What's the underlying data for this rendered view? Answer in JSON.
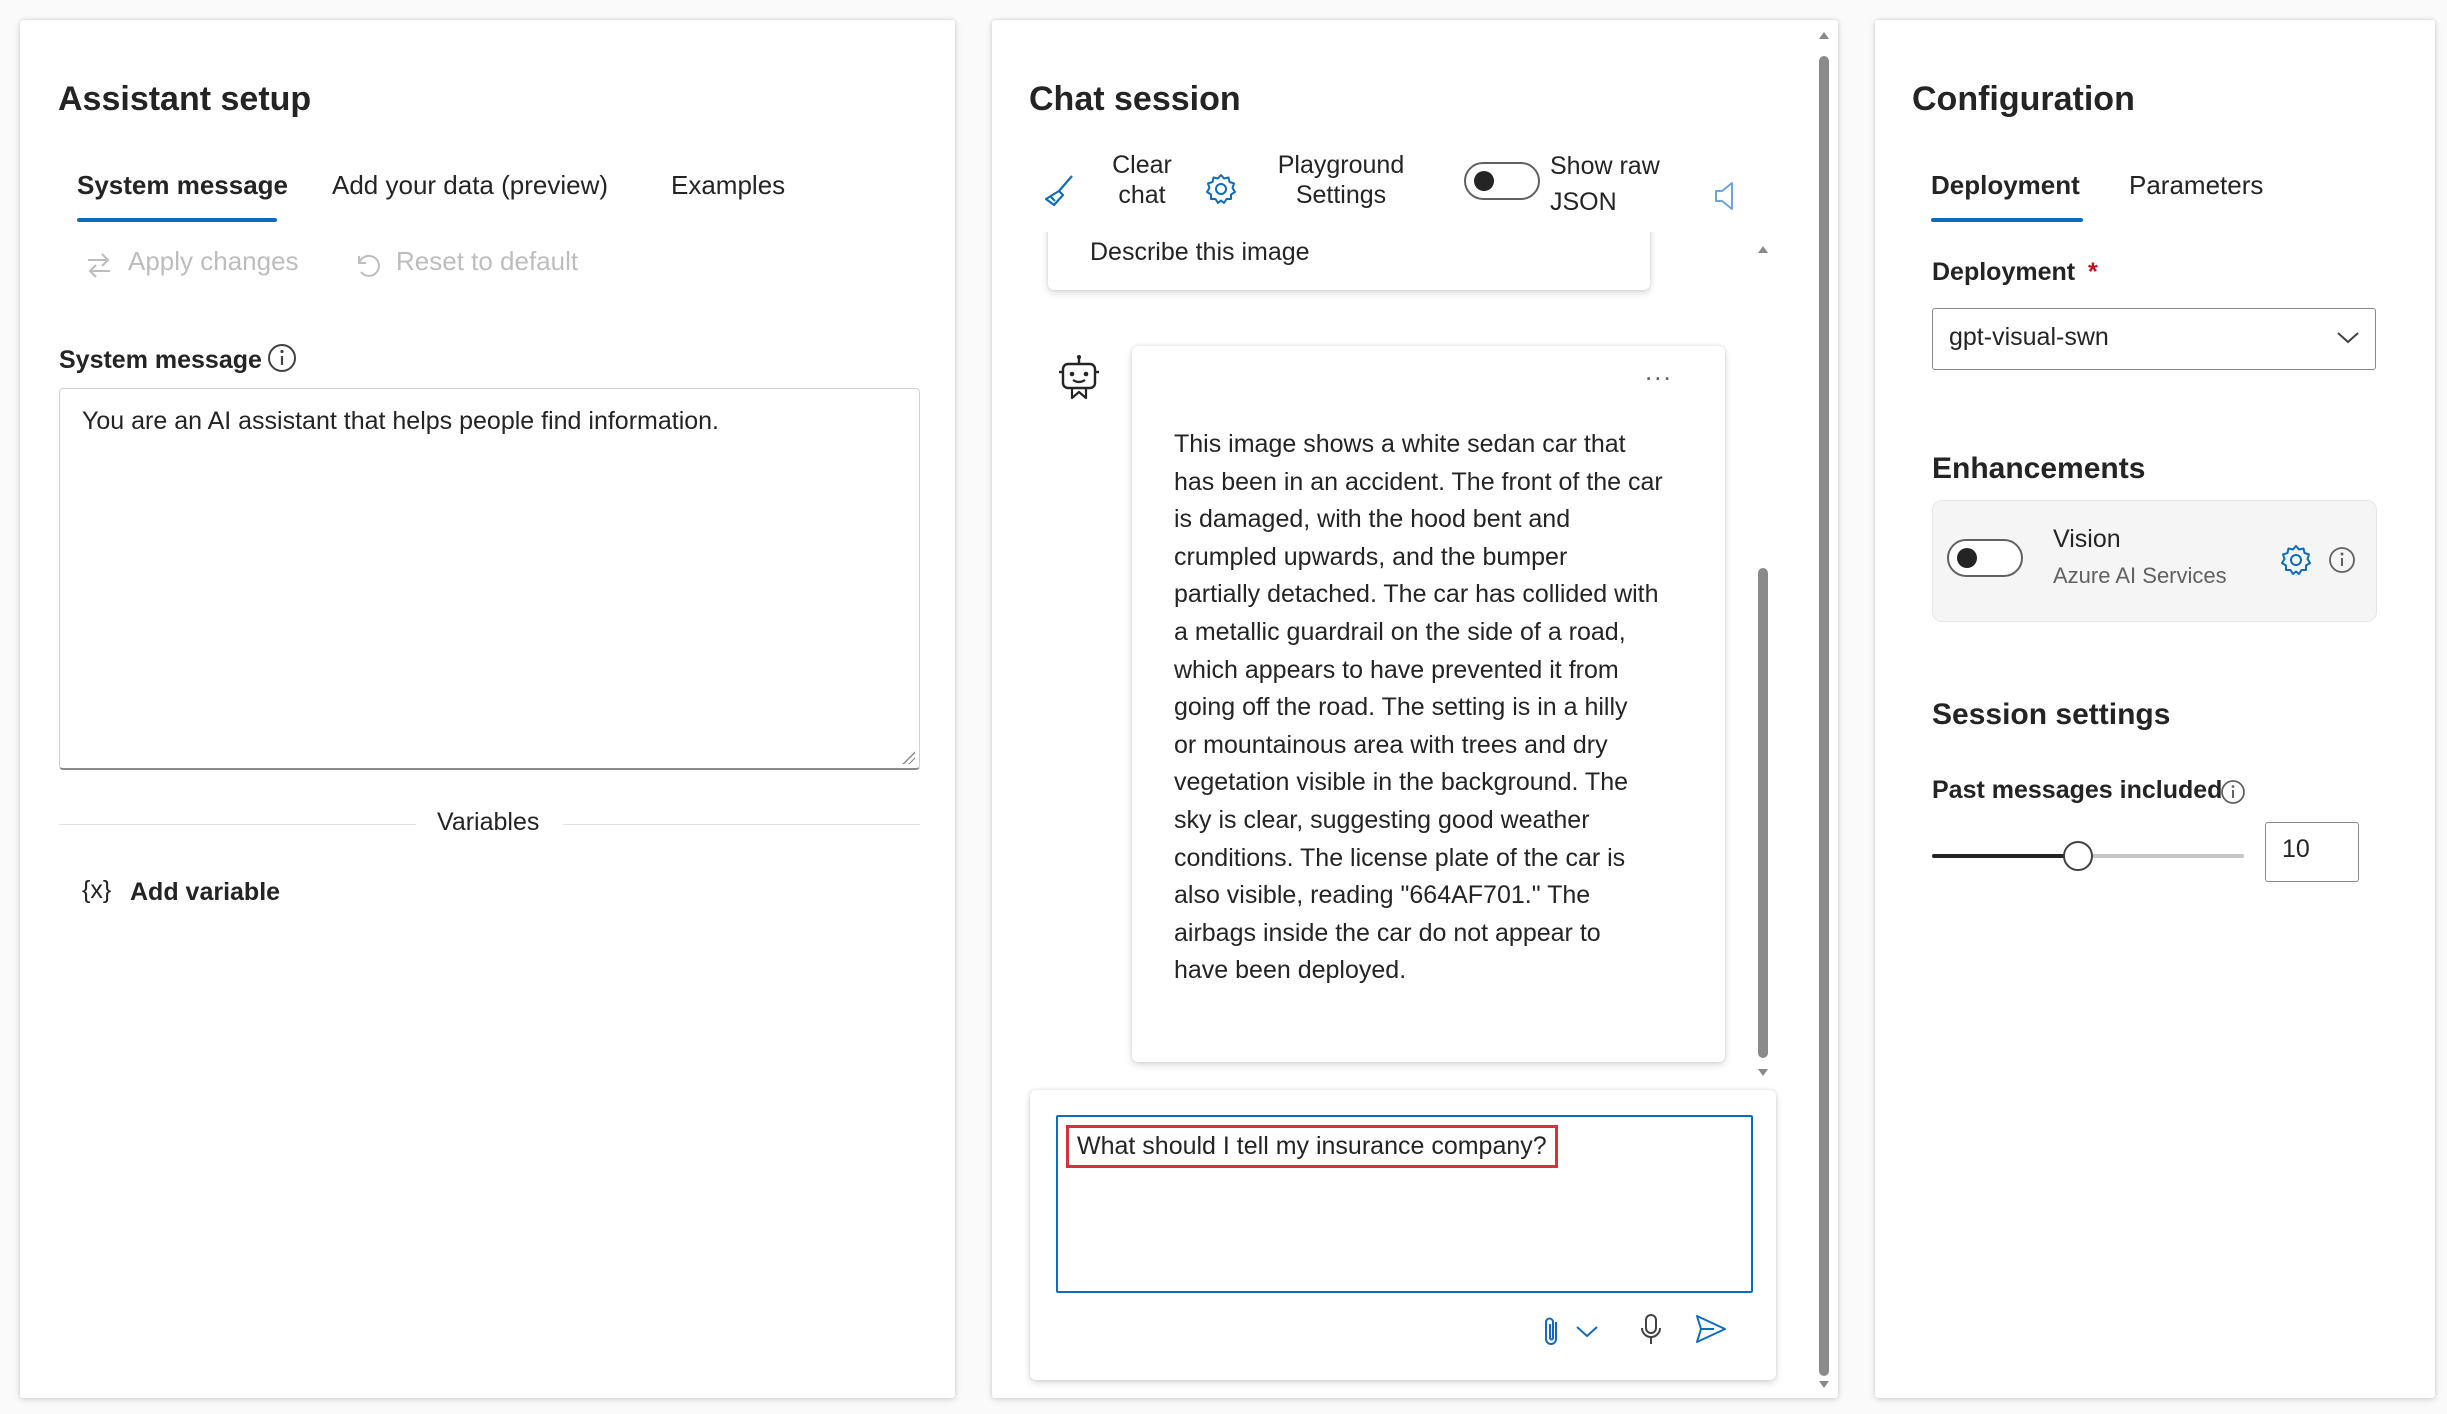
{
  "assistant_setup": {
    "title": "Assistant setup",
    "tabs": [
      {
        "label": "System message",
        "active": true
      },
      {
        "label": "Add your data (preview)",
        "active": false
      },
      {
        "label": "Examples",
        "active": false
      }
    ],
    "apply_changes": "Apply changes",
    "reset_to_default": "Reset to default",
    "system_message_label": "System message",
    "system_message_value": "You are an AI assistant that helps people find information.",
    "variables_label": "Variables",
    "add_variable": "Add variable",
    "add_variable_icon": "{x}"
  },
  "chat_session": {
    "title": "Chat session",
    "toolbar": {
      "clear_chat_line1": "Clear",
      "clear_chat_line2": "chat",
      "playground_settings_line1": "Playground",
      "playground_settings_line2": "Settings",
      "show_raw_json_line1": "Show raw",
      "show_raw_json_line2": "JSON"
    },
    "user_message": "Describe this image",
    "assistant_message_more": "...",
    "assistant_message_lines": [
      "This image shows a white sedan car that",
      "has been in an accident. The front of the car",
      "is damaged, with the hood bent and",
      "crumpled upwards, and the bumper",
      "partially detached. The car has collided with",
      "a metallic guardrail on the side of a road,",
      "which appears to have prevented it from",
      "going off the road. The setting is in a hilly",
      "or mountainous area with trees and dry",
      "vegetation visible in the background. The",
      "sky is clear, suggesting good weather",
      "conditions. The license plate of the car is",
      "also visible, reading \"664AF701.\" The",
      "airbags inside the car do not appear to",
      "have been deployed."
    ],
    "input_value": "What should I tell my insurance company?"
  },
  "configuration": {
    "title": "Configuration",
    "tabs": [
      {
        "label": "Deployment",
        "active": true
      },
      {
        "label": "Parameters",
        "active": false
      }
    ],
    "deployment_label": "Deployment",
    "required_mark": "*",
    "deployment_value": "gpt-visual-swn",
    "enhancements_title": "Enhancements",
    "vision_title": "Vision",
    "vision_subtitle": "Azure AI Services",
    "vision_enabled": false,
    "session_settings_title": "Session settings",
    "past_messages_label": "Past messages included",
    "past_messages_value": "10"
  },
  "colors": {
    "accent": "#0f6cbd",
    "highlight": "#d13438"
  }
}
